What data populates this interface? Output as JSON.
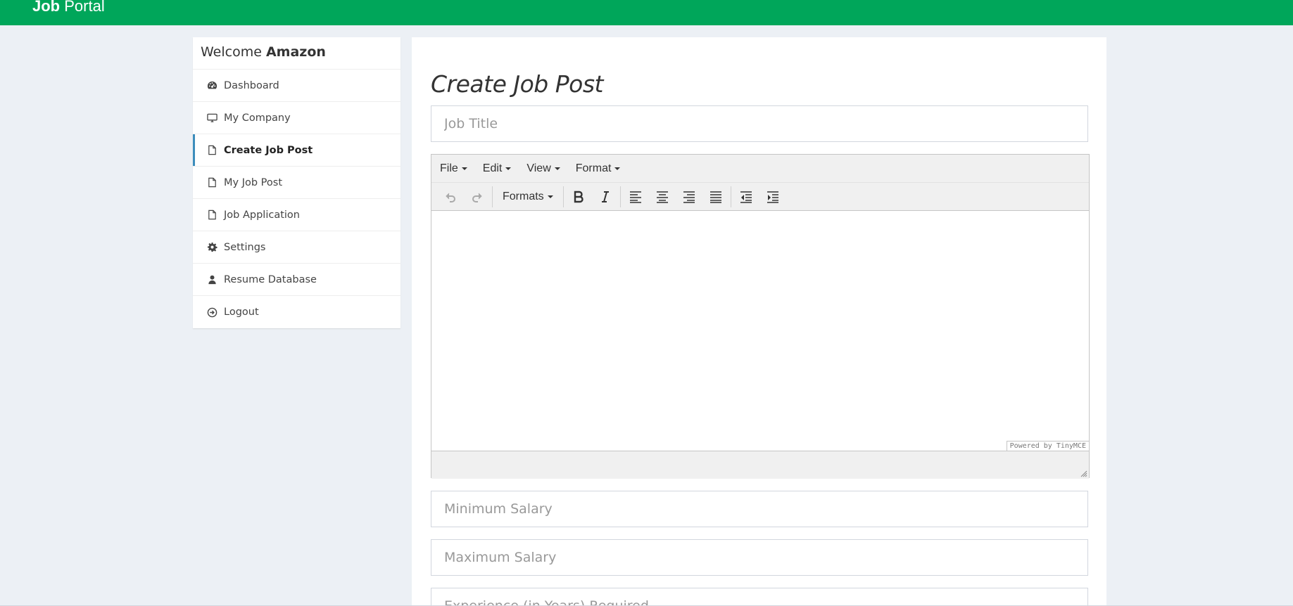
{
  "header": {
    "brand_bold": "Job",
    "brand_rest": " Portal",
    "color": "#00a65a"
  },
  "sidebar": {
    "welcome_prefix": "Welcome ",
    "welcome_name": "Amazon",
    "items": [
      {
        "label": "Dashboard",
        "icon": "dashboard-icon"
      },
      {
        "label": "My Company",
        "icon": "desktop-icon"
      },
      {
        "label": "Create Job Post",
        "icon": "file-icon",
        "active": true
      },
      {
        "label": "My Job Post",
        "icon": "file-icon"
      },
      {
        "label": "Job Application",
        "icon": "file-icon"
      },
      {
        "label": "Settings",
        "icon": "gear-icon"
      },
      {
        "label": "Resume Database",
        "icon": "user-icon"
      },
      {
        "label": "Logout",
        "icon": "logout-icon"
      }
    ],
    "active_color": "#3c8dbc"
  },
  "main": {
    "title": "Create Job Post",
    "job_title_placeholder": "Job Title",
    "min_salary_placeholder": "Minimum Salary",
    "max_salary_placeholder": "Maximum Salary",
    "experience_placeholder": "Experience (in Years) Required"
  },
  "editor": {
    "menu": [
      "File",
      "Edit",
      "View",
      "Format"
    ],
    "formats_label": "Formats",
    "powered_by": "Powered by TinyMCE"
  }
}
